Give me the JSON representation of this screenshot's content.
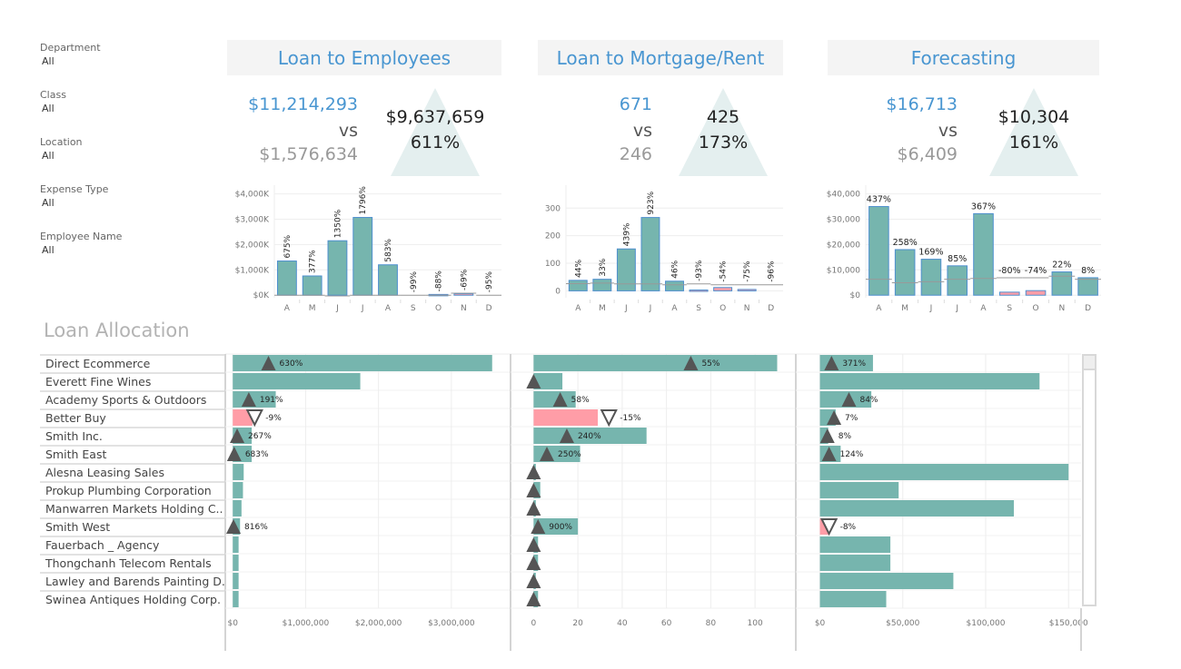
{
  "filters": [
    {
      "label": "Department",
      "value": "All"
    },
    {
      "label": "Class",
      "value": "All"
    },
    {
      "label": "Location",
      "value": "All"
    },
    {
      "label": "Expense Type",
      "value": "All"
    },
    {
      "label": "Employee Name",
      "value": "All"
    }
  ],
  "kpis": [
    {
      "title": "Loan to Employees",
      "current": "$11,214,293",
      "vs": "vs",
      "previous": "$1,576,634",
      "diff": "$9,637,659",
      "pct": "611%"
    },
    {
      "title": "Loan to Mortgage/Rent",
      "current": "671",
      "vs": "vs",
      "previous": "246",
      "diff": "425",
      "pct": "173%"
    },
    {
      "title": "Forecasting",
      "current": "$16,713",
      "vs": "vs",
      "previous": "$6,409",
      "diff": "$10,304",
      "pct": "161%"
    }
  ],
  "section_title": "Loan Allocation",
  "colors": {
    "positive": "#76b5ae",
    "negative": "#ff9da7",
    "bar_outline": "#4e8fcf",
    "marker": "#555555",
    "ref_line": "#999999"
  },
  "chart_data": [
    {
      "type": "bar",
      "title": "Loan to Employees monthly",
      "categories": [
        "A",
        "M",
        "J",
        "J",
        "A",
        "S",
        "O",
        "N",
        "D"
      ],
      "values": [
        1350,
        760,
        2150,
        3070,
        1200,
        0,
        30,
        60,
        0
      ],
      "reference": [
        0,
        0,
        -30,
        0,
        0,
        0,
        0,
        80,
        0
      ],
      "labels": [
        "675%",
        "377%",
        "1350%",
        "1796%",
        "583%",
        "-99%",
        "-88%",
        "-69%",
        "-95%"
      ],
      "ticks": [
        0,
        1000,
        2000,
        3000,
        4000
      ],
      "tick_labels": [
        "$0K",
        "$1,000K",
        "$2,000K",
        "$3,000K",
        "$4,000K"
      ],
      "ylim": [
        -100,
        4200
      ],
      "label_rotated": true
    },
    {
      "type": "bar",
      "title": "Loan to Mortgage/Rent monthly",
      "categories": [
        "A",
        "M",
        "J",
        "J",
        "A",
        "S",
        "O",
        "N",
        "D"
      ],
      "values": [
        38,
        42,
        152,
        266,
        35,
        3,
        12,
        5,
        0
      ],
      "reference": [
        26,
        28,
        25,
        25,
        22,
        25,
        22,
        22,
        22
      ],
      "labels": [
        "44%",
        "33%",
        "439%",
        "923%",
        "46%",
        "-93%",
        "-54%",
        "-75%",
        "-96%"
      ],
      "ticks": [
        0,
        100,
        200,
        300
      ],
      "tick_labels": [
        "0",
        "100",
        "200",
        "300"
      ],
      "ylim": [
        -25,
        370
      ],
      "label_rotated": true
    },
    {
      "type": "bar",
      "title": "Forecasting monthly",
      "categories": [
        "A",
        "M",
        "J",
        "J",
        "A",
        "S",
        "O",
        "N",
        "D"
      ],
      "values": [
        35000,
        18000,
        14200,
        11600,
        32200,
        1200,
        1800,
        9200,
        6900
      ],
      "reference": [
        6300,
        4900,
        5300,
        6300,
        6600,
        6900,
        6900,
        7500,
        6300
      ],
      "labels": [
        "437%",
        "258%",
        "169%",
        "85%",
        "367%",
        "-80%",
        "-74%",
        "22%",
        "8%"
      ],
      "ticks": [
        0,
        10000,
        20000,
        30000,
        40000
      ],
      "tick_labels": [
        "$0",
        "$10,000",
        "$20,000",
        "$30,000",
        "$40,000"
      ],
      "ylim": [
        -1000,
        42000
      ],
      "label_rotated": false
    },
    {
      "type": "bar",
      "title": "Loan Allocation",
      "orientation": "horizontal",
      "categories": [
        "Direct Ecommerce",
        "Everett Fine Wines",
        "Academy Sports & Outdoors",
        "Better Buy",
        "Smith Inc.",
        "Smith East",
        "Alesna Leasing Sales",
        "Prokup Plumbing Corporation",
        "Manwarren Markets Holding C..",
        "Smith West",
        "Fauerbach _ Agency",
        "Thongchanh Telecom Rentals",
        "Lawley and Barends Painting D..",
        "Swinea Antiques Holding Corp."
      ],
      "panels": [
        {
          "name": "Loan to Employees",
          "values": [
            3560000,
            1750000,
            590000,
            270000,
            260000,
            260000,
            150000,
            140000,
            120000,
            100000,
            80000,
            80000,
            80000,
            80000
          ],
          "markers": [
            490000,
            null,
            220000,
            300000,
            60000,
            20000,
            null,
            null,
            null,
            10000,
            null,
            null,
            null,
            null
          ],
          "marker_dir": [
            "up",
            null,
            "up",
            "down",
            "up",
            "up",
            null,
            null,
            null,
            "up",
            null,
            null,
            null,
            null
          ],
          "labels": [
            "630%",
            "",
            "191%",
            "-9%",
            "267%",
            "683%",
            "",
            "",
            "",
            "816%",
            "",
            "",
            "",
            ""
          ],
          "negative": [
            false,
            false,
            false,
            true,
            false,
            false,
            false,
            false,
            false,
            false,
            false,
            false,
            false,
            false
          ],
          "ticks": [
            0,
            1000000,
            2000000,
            3000000
          ],
          "tick_labels": [
            "$0",
            "$1,000,000",
            "$2,000,000",
            "$3,000,000"
          ],
          "xlim": [
            -90000,
            3800000
          ]
        },
        {
          "name": "Loan to Mortgage/Rent",
          "values": [
            110,
            13,
            19,
            29,
            51,
            21,
            1,
            3,
            1,
            20,
            2,
            2,
            1,
            2
          ],
          "markers": [
            71,
            0,
            12,
            34,
            15,
            6,
            0,
            0,
            0,
            2,
            0,
            0,
            0,
            0
          ],
          "marker_dir": [
            "up",
            "up",
            "up",
            "down",
            "up",
            "up",
            "up",
            "up",
            "up",
            "up",
            "up",
            "up",
            "up",
            "up"
          ],
          "labels": [
            "55%",
            "",
            "58%",
            "-15%",
            "240%",
            "250%",
            "",
            "",
            "",
            "900%",
            "",
            "",
            "",
            ""
          ],
          "negative": [
            false,
            false,
            false,
            true,
            false,
            false,
            false,
            false,
            false,
            false,
            false,
            false,
            false,
            false
          ],
          "ticks": [
            0,
            20,
            40,
            60,
            80,
            100
          ],
          "tick_labels": [
            "0",
            "20",
            "40",
            "60",
            "80",
            "100"
          ],
          "xlim": [
            -10,
            118
          ]
        },
        {
          "name": "Forecasting",
          "values": [
            32000,
            132500,
            31000,
            9500,
            5000,
            12500,
            150000,
            47500,
            117000,
            5500,
            42500,
            42500,
            80500,
            40000
          ],
          "markers": [
            7000,
            null,
            17500,
            8500,
            4500,
            5500,
            null,
            null,
            null,
            5500,
            null,
            null,
            null,
            null
          ],
          "marker_dir": [
            "up",
            null,
            "up",
            "up",
            "up",
            "up",
            null,
            null,
            null,
            "down",
            null,
            null,
            null,
            null
          ],
          "labels": [
            "371%",
            "",
            "84%",
            "7%",
            "8%",
            "124%",
            "",
            "",
            "",
            "-8%",
            "",
            "",
            "",
            ""
          ],
          "negative": [
            false,
            false,
            false,
            false,
            false,
            false,
            false,
            false,
            false,
            true,
            false,
            false,
            false,
            false
          ],
          "ticks": [
            0,
            50000,
            100000,
            150000
          ],
          "tick_labels": [
            "$0",
            "$50,000",
            "$100,000",
            "$150,000"
          ],
          "xlim": [
            -14000,
            157000
          ]
        }
      ]
    }
  ]
}
